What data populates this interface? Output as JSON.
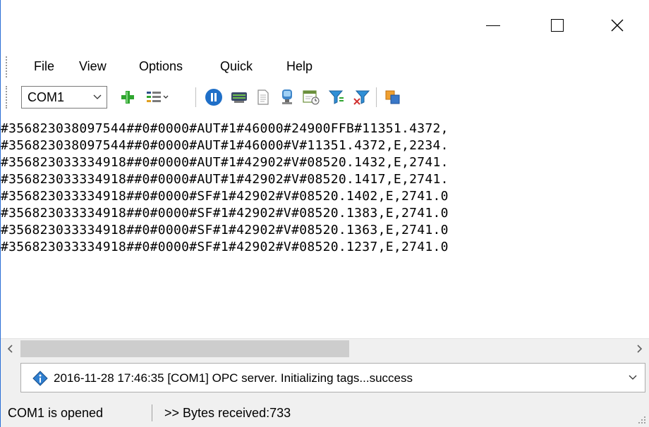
{
  "window": {
    "controls": [
      "minimize",
      "maximize",
      "close"
    ]
  },
  "menu": {
    "items": [
      "File",
      "View",
      "Options",
      "Quick",
      "Help"
    ]
  },
  "toolbar": {
    "port_select": {
      "value": "COM1"
    },
    "icons": [
      "add-icon",
      "columns-menu-icon",
      "pause-icon",
      "serial-port-icon",
      "document-icon",
      "monitor-icon",
      "scheduler-icon",
      "filter-icon",
      "filter-remove-icon",
      "export-icon"
    ]
  },
  "terminal": {
    "lines": [
      "#356823038097544##0#0000#AUT#1#46000#24900FFB#11351.4372,",
      "#356823038097544##0#0000#AUT#1#46000#V#11351.4372,E,2234.",
      "#356823033334918##0#0000#AUT#1#42902#V#08520.1432,E,2741.",
      "#356823033334918##0#0000#AUT#1#42902#V#08520.1417,E,2741.",
      "#356823033334918##0#0000#SF#1#42902#V#08520.1402,E,2741.0",
      "#356823033334918##0#0000#SF#1#42902#V#08520.1383,E,2741.0",
      "#356823033334918##0#0000#SF#1#42902#V#08520.1363,E,2741.0",
      "#356823033334918##0#0000#SF#1#42902#V#08520.1237,E,2741.0"
    ]
  },
  "log": {
    "message": "2016-11-28 17:46:35 [COM1] OPC server. Initializing tags...success"
  },
  "status": {
    "port_state": "COM1 is opened",
    "bytes_received": ">> Bytes received:733"
  },
  "colors": {
    "window_border": "#2b6fd6",
    "chrome_bg": "#f0f0f0",
    "scroll_thumb": "#cdcdcd",
    "add_icon": "#2fa52f",
    "pause_icon": "#1f6fc8"
  }
}
